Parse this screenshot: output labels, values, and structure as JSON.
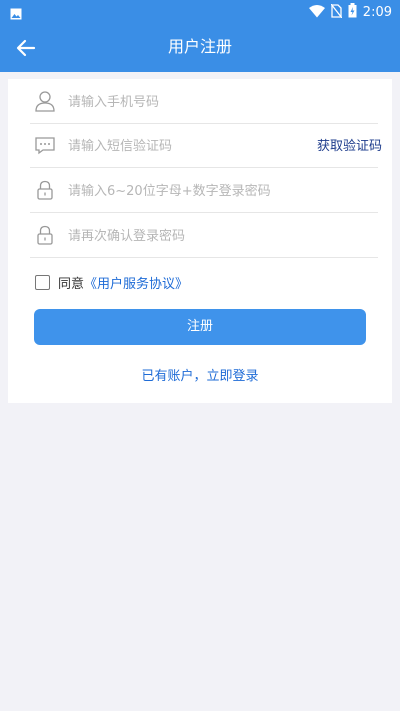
{
  "status_bar": {
    "time": "2:09",
    "icons": [
      "image-icon",
      "wifi-icon",
      "no-sim-icon",
      "battery-charging-icon"
    ]
  },
  "header": {
    "title": "用户注册",
    "back_icon": "arrow-left-icon"
  },
  "form": {
    "phone": {
      "placeholder": "请输入手机号码",
      "value": "",
      "icon": "user-icon"
    },
    "sms_code": {
      "placeholder": "请输入短信验证码",
      "value": "",
      "icon": "message-icon",
      "get_code_label": "获取验证码"
    },
    "password": {
      "placeholder": "请输入6~20位字母+数字登录密码",
      "value": "",
      "icon": "lock-icon"
    },
    "confirm_password": {
      "placeholder": "请再次确认登录密码",
      "value": "",
      "icon": "lock-icon"
    }
  },
  "agreement": {
    "checked": false,
    "prefix": "同意",
    "link_label": "《用户服务协议》"
  },
  "register_button": "注册",
  "login_link": "已有账户，立即登录",
  "colors": {
    "primary": "#3a8ee6",
    "button": "#3f93eb",
    "link": "#1e6bd6",
    "background": "#f2f2f7"
  }
}
